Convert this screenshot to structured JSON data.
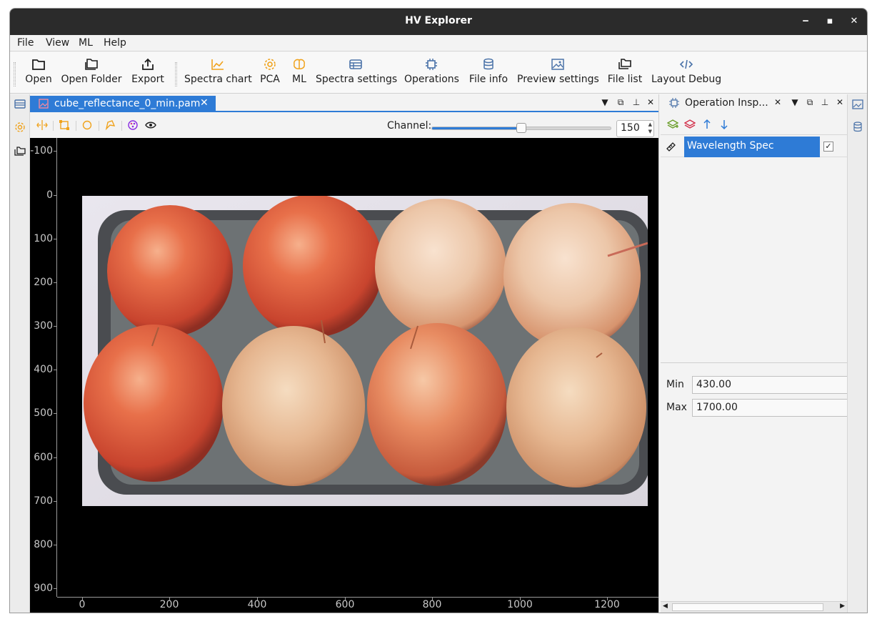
{
  "window": {
    "title": "HV Explorer",
    "minimize": "‒",
    "maximize": "▪",
    "close": "✕"
  },
  "menu": [
    "File",
    "View",
    "ML",
    "Help"
  ],
  "toolbar": {
    "open": "Open",
    "open_folder": "Open Folder",
    "export": "Export",
    "spectra_chart": "Spectra chart",
    "pca": "PCA",
    "ml": "ML",
    "spectra_settings": "Spectra settings",
    "operations": "Operations",
    "file_info": "File info",
    "preview_settings": "Preview settings",
    "file_list": "File list",
    "layout_debug": "Layout Debug"
  },
  "colors": {
    "accent": "#2e7bd6",
    "orange_icon": "#f0a21b",
    "dark_icon": "#1e1e1e",
    "steel_icon": "#4a72a8"
  },
  "editor": {
    "tab_label": "cube_reflectance_0_min.pam",
    "tab_close": "✕",
    "channel_label": "Channel:",
    "channel_value": "150",
    "channel_fraction": 0.5
  },
  "axes": {
    "y_ticks": [
      "-100",
      "0",
      "100",
      "200",
      "300",
      "400",
      "500",
      "600",
      "700",
      "800",
      "900"
    ],
    "x_ticks": [
      "0",
      "200",
      "400",
      "600",
      "800",
      "1000",
      "1200"
    ]
  },
  "inspector": {
    "title": "Operation Insp...",
    "close": "✕",
    "operation_name": "Wavelength Spec",
    "operation_checked": "✓",
    "min_label": "Min",
    "min_value": "430.00",
    "max_label": "Max",
    "max_value": "1700.00"
  }
}
